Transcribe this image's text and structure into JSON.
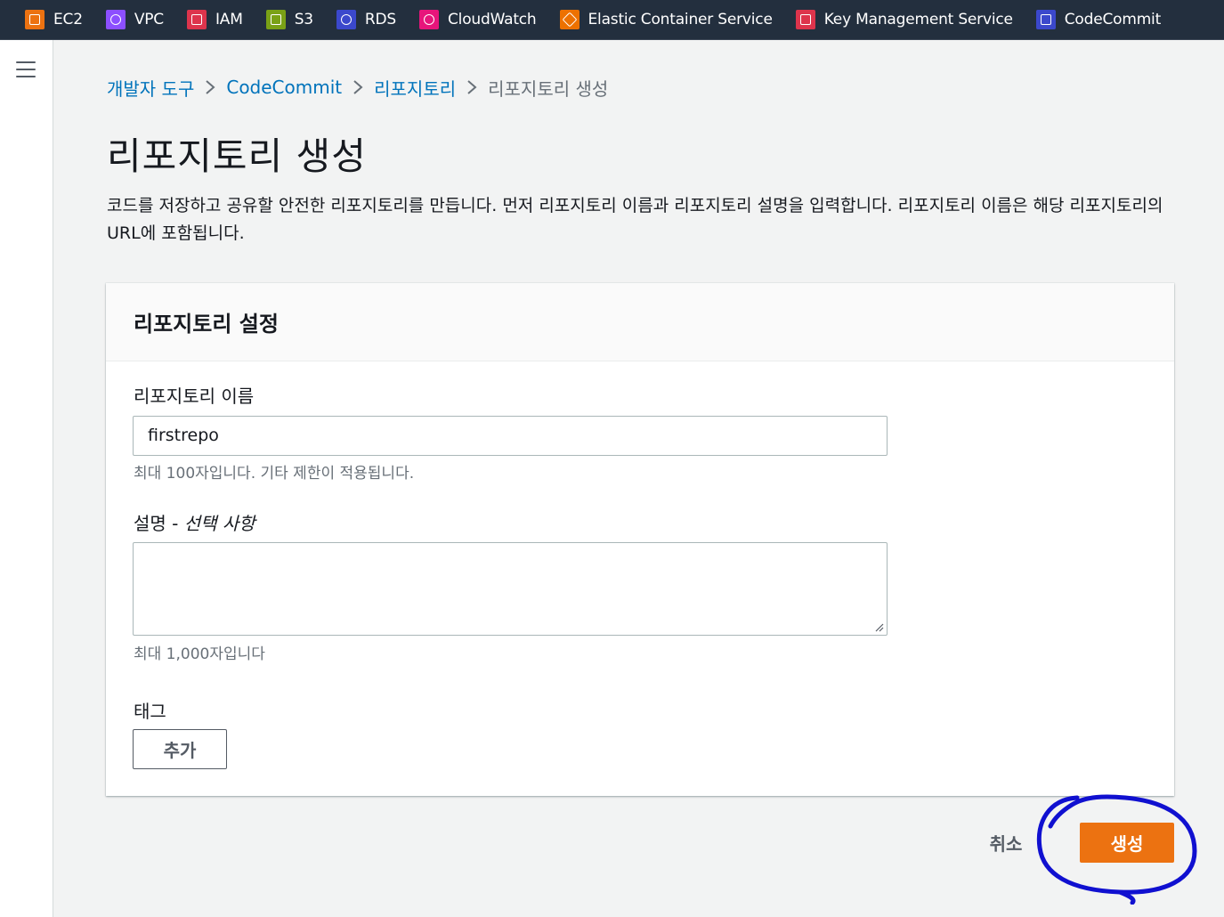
{
  "favorites": [
    {
      "label": "EC2",
      "icon": "ec2-icon",
      "color": "#ec7211"
    },
    {
      "label": "VPC",
      "icon": "vpc-icon",
      "color": "#8c4fff"
    },
    {
      "label": "IAM",
      "icon": "iam-icon",
      "color": "#dd344c"
    },
    {
      "label": "S3",
      "icon": "s3-icon",
      "color": "#7aa116"
    },
    {
      "label": "RDS",
      "icon": "rds-icon",
      "color": "#3b48cc"
    },
    {
      "label": "CloudWatch",
      "icon": "cloudwatch-icon",
      "color": "#e7157b"
    },
    {
      "label": "Elastic Container Service",
      "icon": "ecs-icon",
      "color": "#ed7100"
    },
    {
      "label": "Key Management Service",
      "icon": "kms-icon",
      "color": "#dd344c"
    },
    {
      "label": "CodeCommit",
      "icon": "codecommit-icon",
      "color": "#3b48cc"
    }
  ],
  "breadcrumb": {
    "items": [
      "개발자 도구",
      "CodeCommit",
      "리포지토리"
    ],
    "current": "리포지토리 생성"
  },
  "page": {
    "title": "리포지토리 생성",
    "description": "코드를 저장하고 공유할 안전한 리포지토리를 만듭니다. 먼저 리포지토리 이름과 리포지토리 설명을 입력합니다. 리포지토리 이름은 해당 리포지토리의 URL에 포함됩니다."
  },
  "settings": {
    "header": "리포지토리 설정",
    "name_label": "리포지토리 이름",
    "name_value": "firstrepo",
    "name_hint": "최대 100자입니다. 기타 제한이 적용됩니다.",
    "description_label": "설명 - ",
    "description_optional": "선택 사항",
    "description_value": "",
    "description_hint": "최대 1,000자입니다",
    "tags_label": "태그",
    "add_button": "추가"
  },
  "actions": {
    "cancel": "취소",
    "create": "생성"
  },
  "colors": {
    "accent": "#ec7211",
    "link": "#0073bb",
    "annotation": "#1010d0"
  }
}
